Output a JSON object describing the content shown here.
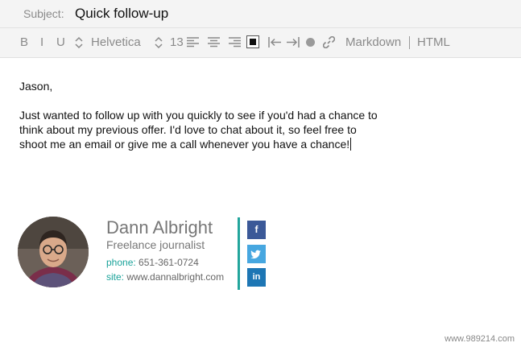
{
  "subject": {
    "label": "Subject:",
    "value": "Quick follow-up"
  },
  "toolbar": {
    "bold": "B",
    "italic": "I",
    "underline": "U",
    "font": "Helvetica",
    "size": "13",
    "markdown": "Markdown",
    "html": "HTML"
  },
  "body": {
    "greeting": "Jason,",
    "lines": [
      "Just wanted to follow up with you quickly to see if you'd had a chance to",
      "think about my previous offer. I'd love to chat about it, so feel free to",
      "shoot me an email or give me a call whenever you have a chance!"
    ]
  },
  "signature": {
    "name": "Dann Albright",
    "title": "Freelance journalist",
    "phone_label": "phone:",
    "phone": "651-361-0724",
    "site_label": "site:",
    "site": "www.dannalbright.com",
    "accent_color": "#22a59c"
  },
  "social": {
    "facebook": "f",
    "linkedin": "in"
  },
  "watermark": "www.989214.com"
}
